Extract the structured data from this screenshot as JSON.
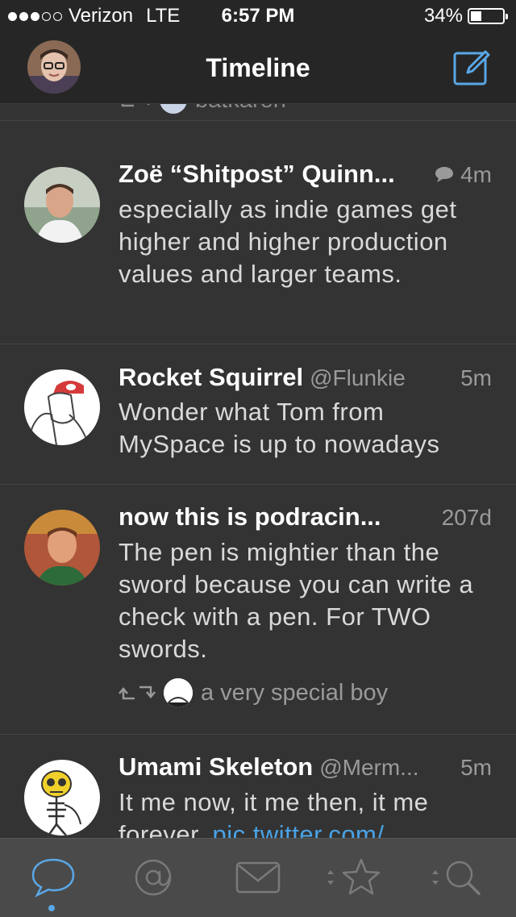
{
  "status_bar": {
    "carrier": "Verizon",
    "network": "LTE",
    "time": "6:57 PM",
    "battery": "34%",
    "battery_level": 0.34,
    "signal_bars_filled": 3,
    "signal_bars_total": 5
  },
  "nav": {
    "title": "Timeline",
    "compose_icon": "compose-icon",
    "accent_color": "#5aa7e6"
  },
  "partial_top": {
    "text": "batkaren",
    "icon": "retweet-icon"
  },
  "tweets": [
    {
      "name": "Zoë “Shitpost” Quinn...",
      "handle": "",
      "time": "4m",
      "has_reply_icon": true,
      "body": "especially as indie games get higher and higher production values and larger teams."
    },
    {
      "name": "Rocket Squirrel",
      "handle": "@Flunkie",
      "time": "5m",
      "body": "Wonder what Tom from MySpace is up to nowadays"
    },
    {
      "name": "now this is podracin...",
      "handle": "",
      "time": "207d",
      "body": "The pen is mightier than the sword because you can write a check with a pen. For TWO swords.",
      "retweeted_by": "a very special boy"
    },
    {
      "name": "Umami Skeleton",
      "handle": "@Merm...",
      "time": "5m",
      "body": "It me now, it me then, it me forever. ",
      "link": "pic.twitter.com/"
    }
  ],
  "tabs": [
    {
      "icon": "chat-bubble-icon",
      "active": true
    },
    {
      "icon": "at-sign-icon",
      "active": false
    },
    {
      "icon": "envelope-icon",
      "active": false
    },
    {
      "icon": "star-icon",
      "active": false
    },
    {
      "icon": "search-icon",
      "active": false
    }
  ],
  "colors": {
    "background": "#333333",
    "bars": "#262626",
    "tabbar": "#4a4a4a",
    "link": "#4aa3e6"
  }
}
